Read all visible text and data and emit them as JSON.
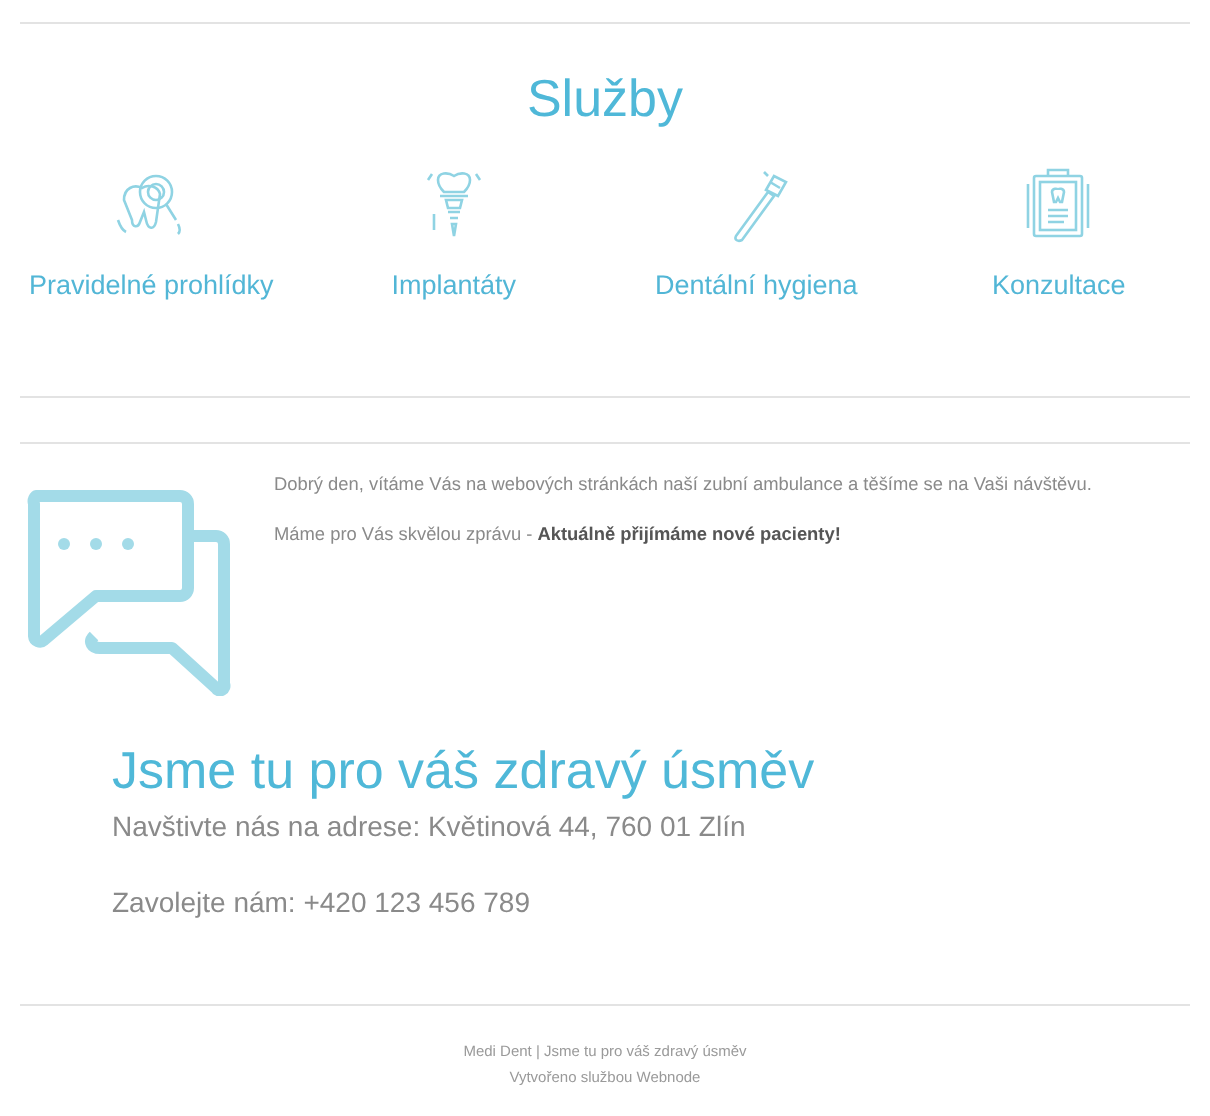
{
  "services": {
    "title": "Služby",
    "items": [
      {
        "kind": "checkup",
        "label": "Pravidelné prohlídky"
      },
      {
        "kind": "implant",
        "label": "Implantáty"
      },
      {
        "kind": "toothbrush",
        "label": "Dentální hygiena"
      },
      {
        "kind": "clipboard",
        "label": "Konzultace"
      }
    ]
  },
  "message": {
    "paragraphs": [
      "Dobrý den, vítáme Vás na webových stránkách naší zubní ambulance a těšíme se na Vaši návštěvu.",
      "Máme pro Vás skvělou zprávu - **Aktuálně přijímáme nové pacienty!**"
    ]
  },
  "contact": {
    "heading": "Jsme tu pro váš zdravý úsměv",
    "address": "Navštivte nás na adrese: Květinová 44, 760 01 Zlín",
    "phone": "Zavolejte nám: +420 123 456 789"
  },
  "footer": {
    "lines": [
      "Medi Dent | Jsme tu pro váš zdravý úsměv",
      "Vytvořeno službou Webnode"
    ]
  }
}
